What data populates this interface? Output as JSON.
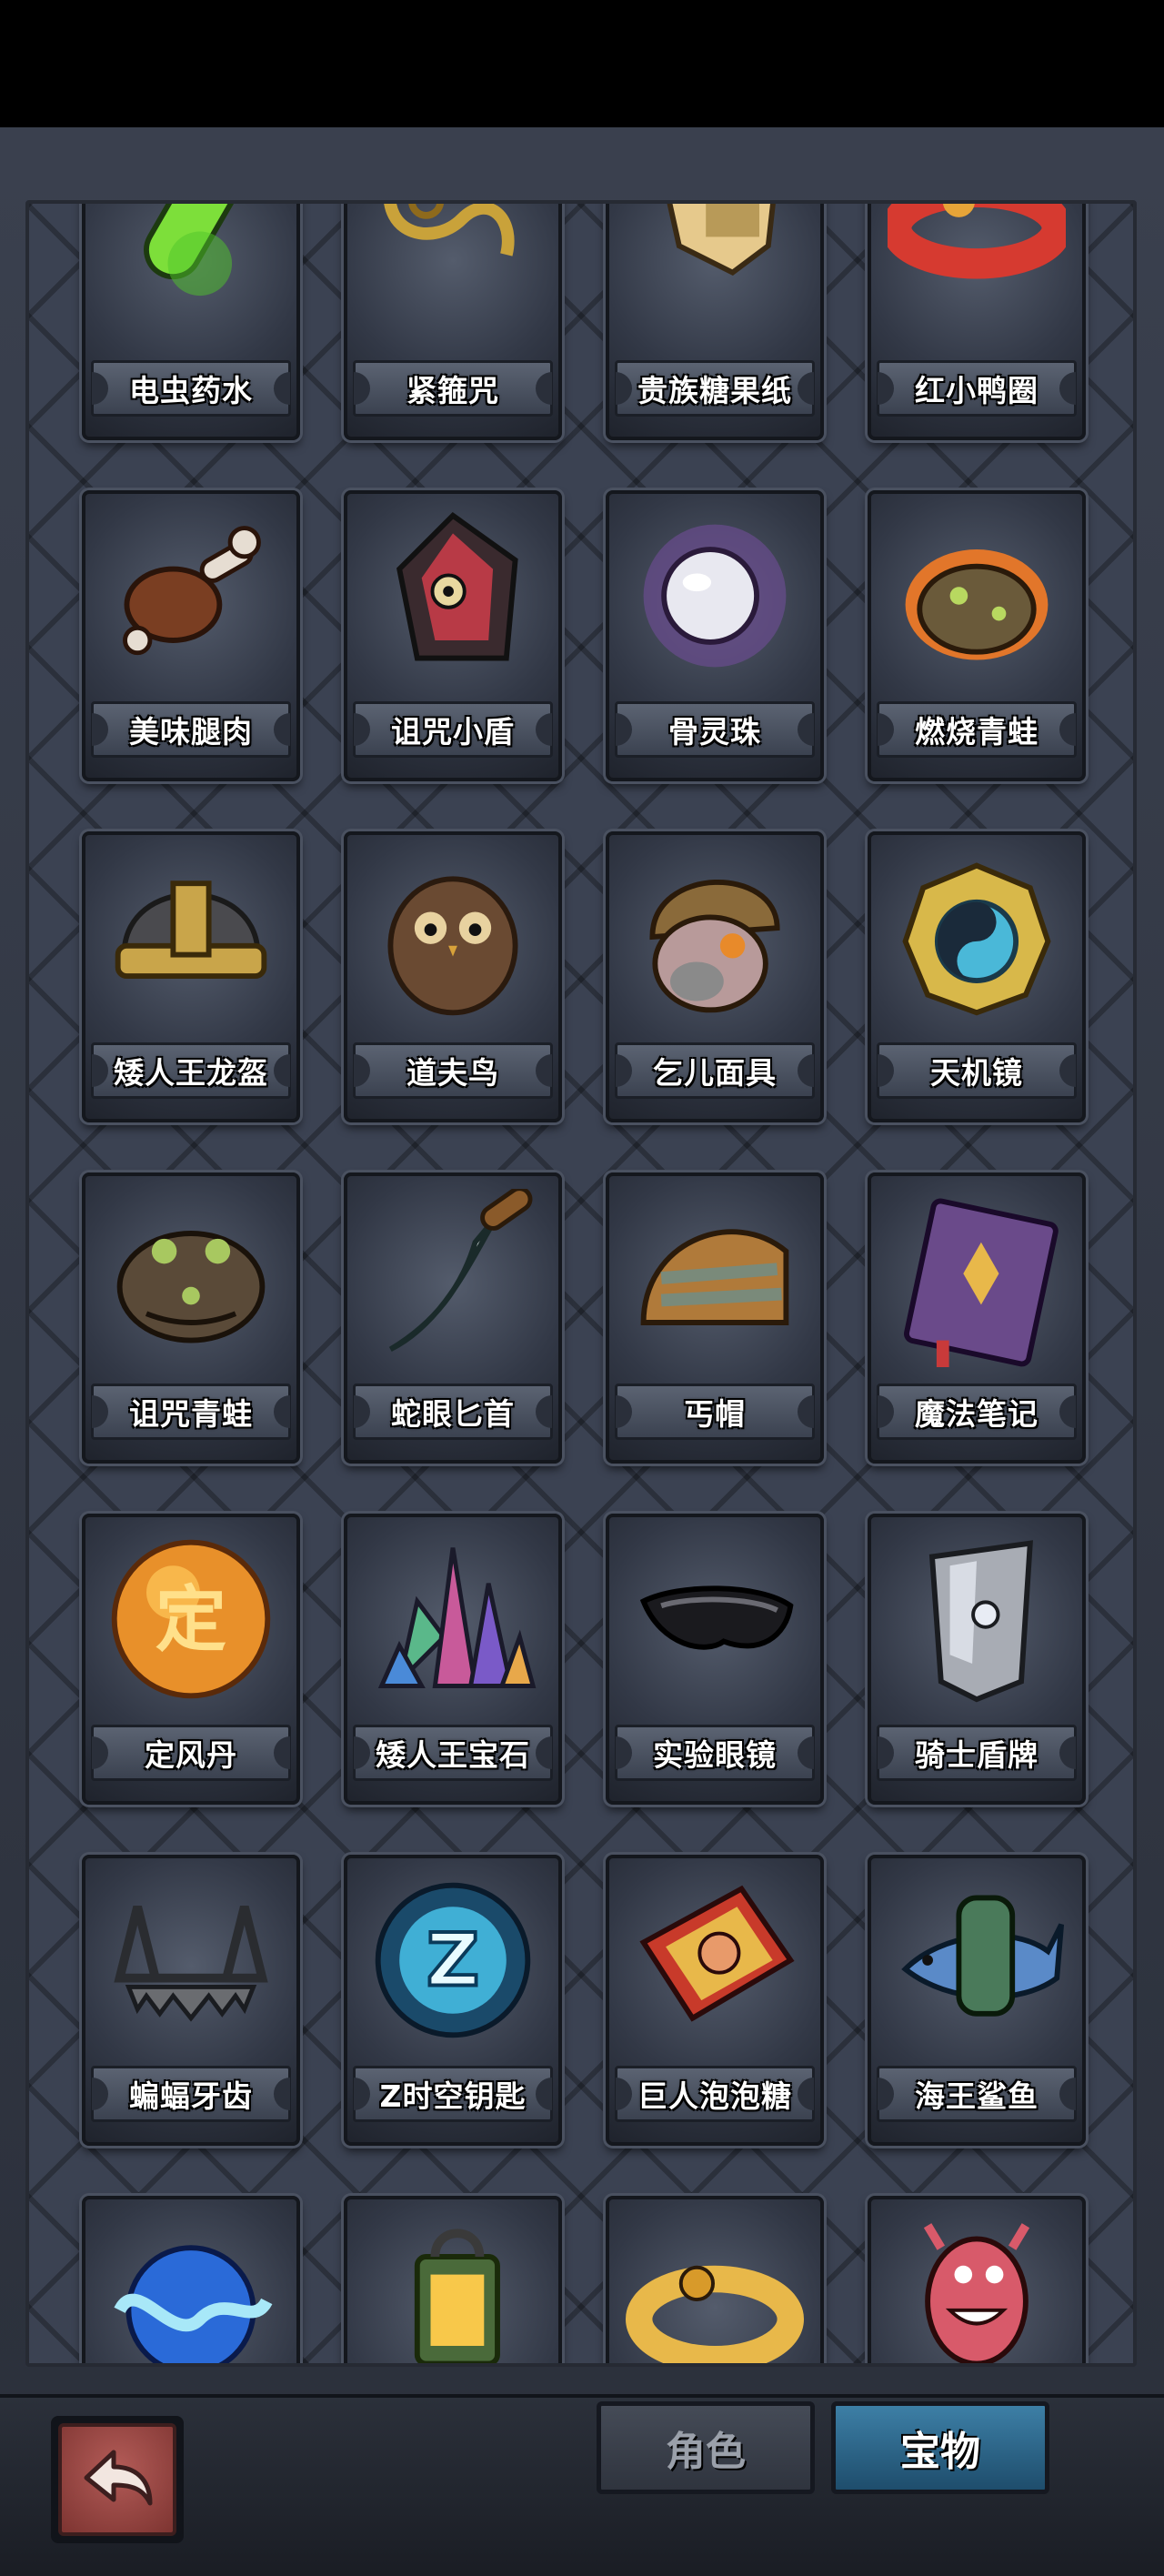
{
  "items": [
    {
      "name": "电虫药水",
      "icon": "green-potion-icon"
    },
    {
      "name": "紧箍咒",
      "icon": "golden-circlet-icon"
    },
    {
      "name": "贵族糖果纸",
      "icon": "candy-wrapper-icon"
    },
    {
      "name": "红小鸭圈",
      "icon": "red-duck-float-icon"
    },
    {
      "name": "美味腿肉",
      "icon": "meat-leg-icon"
    },
    {
      "name": "诅咒小盾",
      "icon": "cursed-shield-icon"
    },
    {
      "name": "骨灵珠",
      "icon": "spirit-orb-icon"
    },
    {
      "name": "燃烧青蛙",
      "icon": "burning-frog-icon"
    },
    {
      "name": "矮人王龙盔",
      "icon": "dwarf-helmet-icon"
    },
    {
      "name": "道夫鸟",
      "icon": "owl-bird-icon"
    },
    {
      "name": "乞儿面具",
      "icon": "beggar-mask-icon"
    },
    {
      "name": "天机镜",
      "icon": "bagua-mirror-icon"
    },
    {
      "name": "诅咒青蛙",
      "icon": "cursed-frog-icon"
    },
    {
      "name": "蛇眼匕首",
      "icon": "curved-dagger-icon"
    },
    {
      "name": "丐帽",
      "icon": "beggar-hat-icon"
    },
    {
      "name": "魔法笔记",
      "icon": "spell-book-icon"
    },
    {
      "name": "定风丹",
      "icon": "wind-pill-orb-icon",
      "glyph": "定"
    },
    {
      "name": "矮人王宝石",
      "icon": "gem-crystals-icon"
    },
    {
      "name": "实验眼镜",
      "icon": "goggles-icon"
    },
    {
      "name": "骑士盾牌",
      "icon": "knight-shield-icon"
    },
    {
      "name": "蝙蝠牙齿",
      "icon": "bat-teeth-icon"
    },
    {
      "name": "Z时空钥匙",
      "icon": "z-key-orb-icon",
      "glyph": "Z"
    },
    {
      "name": "巨人泡泡糖",
      "icon": "bubblegum-box-icon"
    },
    {
      "name": "海王鲨鱼",
      "icon": "shark-icon"
    },
    {
      "name": "",
      "icon": "water-orb-icon"
    },
    {
      "name": "",
      "icon": "lantern-icon"
    },
    {
      "name": "",
      "icon": "yellow-duck-float-icon"
    },
    {
      "name": "",
      "icon": "pink-monster-icon"
    }
  ],
  "tabs": {
    "role": "角色",
    "treasure": "宝物",
    "active": "treasure"
  },
  "colors": {
    "active_tab": "#2f6a90",
    "back_button": "#9e4a47"
  }
}
